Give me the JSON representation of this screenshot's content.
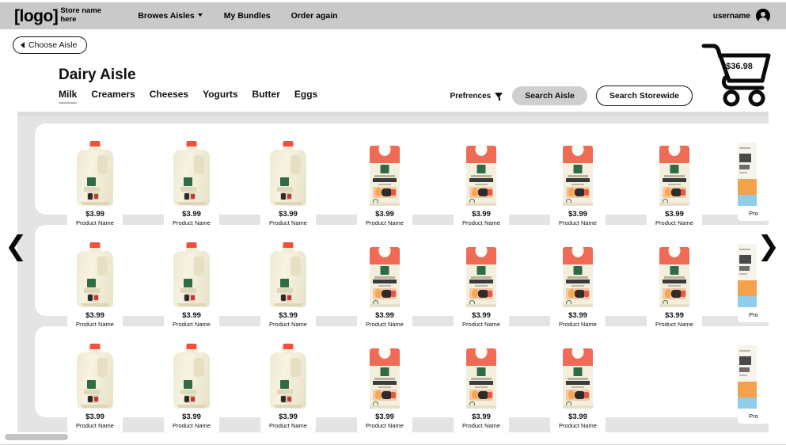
{
  "topbar": {
    "logo": "[logo]",
    "store_name": "Store name here",
    "nav": [
      {
        "label": "Browes Aisles",
        "has_caret": true,
        "icon": "chevron-down-icon"
      },
      {
        "label": "My Bundles",
        "has_caret": false
      },
      {
        "label": "Order again",
        "has_caret": false
      }
    ],
    "username": "username",
    "user_icon": "user-avatar-icon",
    "background": "#c9c9c9"
  },
  "choose_aisle": {
    "label": "Choose Aisle",
    "icon": "chevron-left-icon"
  },
  "page": {
    "title": "Dairy Aisle",
    "tabs": [
      {
        "label": "Milk",
        "active": true
      },
      {
        "label": "Creamers",
        "active": false
      },
      {
        "label": "Cheeses",
        "active": false
      },
      {
        "label": "Yogurts",
        "active": false
      },
      {
        "label": "Butter",
        "active": false
      },
      {
        "label": "Eggs",
        "active": false
      }
    ]
  },
  "controls": {
    "preferences_label": "Prefrences",
    "filter_icon": "filter-funnel-icon",
    "search_aisle": "Search Aisle",
    "search_storewide": "Search Storewide"
  },
  "cart": {
    "icon": "shopping-cart-icon",
    "amount": "$36.98"
  },
  "carousel": {
    "prev_icon": "chevron-left-icon",
    "next_icon": "chevron-right-icon",
    "rows": [
      {
        "products": [
          {
            "kind": "jug",
            "price": "$3.99",
            "name": "Product Name"
          },
          {
            "kind": "jug",
            "price": "$3.99",
            "name": "Product Name"
          },
          {
            "kind": "jug",
            "price": "$3.99",
            "name": "Product Name"
          },
          {
            "kind": "carton",
            "price": "$3.99",
            "name": "Product Name"
          },
          {
            "kind": "carton",
            "price": "$3.99",
            "name": "Product Name"
          },
          {
            "kind": "carton",
            "price": "$3.99",
            "name": "Product Name"
          },
          {
            "kind": "carton",
            "price": "$3.99",
            "name": "Product Name"
          },
          {
            "kind": "partial",
            "price": "",
            "name": "Pro"
          }
        ]
      },
      {
        "products": [
          {
            "kind": "jug",
            "price": "$3.99",
            "name": "Product Name"
          },
          {
            "kind": "jug",
            "price": "$3.99",
            "name": "Product Name"
          },
          {
            "kind": "jug",
            "price": "$3.99",
            "name": "Product Name"
          },
          {
            "kind": "carton",
            "price": "$3.99",
            "name": "Product Name"
          },
          {
            "kind": "carton",
            "price": "$3.99",
            "name": "Product Name"
          },
          {
            "kind": "carton",
            "price": "$3.99",
            "name": "Product Name"
          },
          {
            "kind": "carton",
            "price": "$3.99",
            "name": "Product Name"
          },
          {
            "kind": "partial",
            "price": "",
            "name": "Pro"
          }
        ]
      },
      {
        "products": [
          {
            "kind": "jug",
            "price": "$3.99",
            "name": "Product Name"
          },
          {
            "kind": "jug",
            "price": "$3.99",
            "name": "Product Name"
          },
          {
            "kind": "jug",
            "price": "$3.99",
            "name": "Product Name"
          },
          {
            "kind": "carton",
            "price": "$3.99",
            "name": "Product Name"
          },
          {
            "kind": "carton",
            "price": "$3.99",
            "name": "Product Name"
          },
          {
            "kind": "carton",
            "price": "$3.99",
            "name": "Product Name"
          },
          {
            "kind": "partial",
            "price": "",
            "name": "Pro"
          }
        ]
      }
    ]
  },
  "scrollbar": {
    "horizontal_thumb": "horizontal-scrollbar-thumb"
  },
  "colors": {
    "topbar_bg": "#c9c9c9",
    "page_bg": "#ffffff",
    "carousel_bg": "#e4e4e4",
    "card_bg": "#ffffff",
    "pill_filled_bg": "#cfcfcf",
    "tab_underline": "#b8b8b8",
    "text": "#111111"
  }
}
